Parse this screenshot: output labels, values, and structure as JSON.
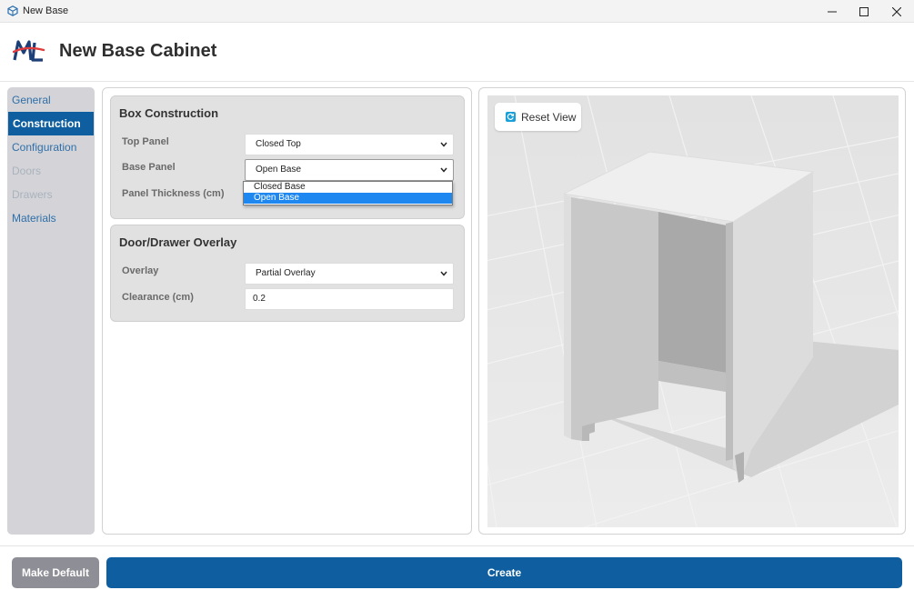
{
  "window": {
    "title": "New Base",
    "app_icon": "cube-icon",
    "controls": [
      "minimize-icon",
      "maximize-icon",
      "close-icon"
    ]
  },
  "header": {
    "logo": "ml-logo",
    "title": "New Base Cabinet"
  },
  "sidebar": {
    "items": [
      {
        "label": "General",
        "state": "normal"
      },
      {
        "label": "Construction",
        "state": "active"
      },
      {
        "label": "Configuration",
        "state": "normal"
      },
      {
        "label": "Doors",
        "state": "disabled"
      },
      {
        "label": "Drawers",
        "state": "disabled"
      },
      {
        "label": "Materials",
        "state": "normal"
      }
    ]
  },
  "box_construction": {
    "title": "Box Construction",
    "top_panel": {
      "label": "Top Panel",
      "value": "Closed Top"
    },
    "base_panel": {
      "label": "Base Panel",
      "value": "Open Base",
      "options": [
        "Closed Base",
        "Open Base"
      ],
      "open": true
    },
    "panel_thickness": {
      "label": "Panel Thickness (cm)"
    }
  },
  "overlay": {
    "title": "Door/Drawer Overlay",
    "overlay": {
      "label": "Overlay",
      "value": "Partial Overlay"
    },
    "clearance": {
      "label": "Clearance (cm)",
      "value": "0.2"
    }
  },
  "preview": {
    "reset_label": "Reset View",
    "reset_icon": "reset-view-icon"
  },
  "footer": {
    "make_default_label": "Make Default",
    "create_label": "Create"
  },
  "colors": {
    "accent": "#0f5fa0",
    "sidebar_bg": "#d4d4d8",
    "link": "#2f6fa8",
    "secondary_button": "#8e8e96",
    "selection": "#1e88f0"
  }
}
